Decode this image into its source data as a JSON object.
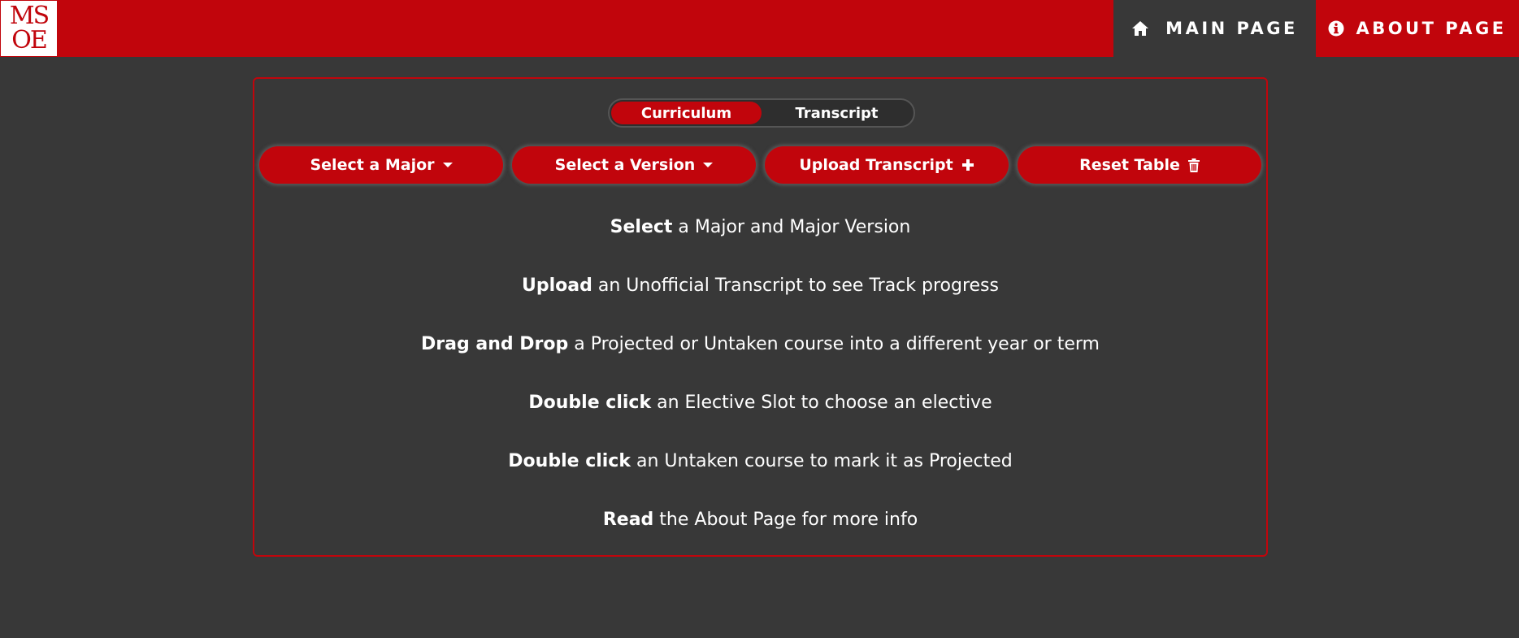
{
  "colors": {
    "brand_red": "#c1050c",
    "background": "#383838",
    "text": "#ffffff"
  },
  "logo": {
    "line1": "MS",
    "line2": "OE"
  },
  "nav": {
    "main_page": {
      "icon": "home-icon",
      "label": "MAIN PAGE"
    },
    "about_page": {
      "icon": "info-circle-icon",
      "label": "ABOUT PAGE"
    }
  },
  "toggle": {
    "options": [
      "Curriculum",
      "Transcript"
    ],
    "active": "Curriculum"
  },
  "buttons": {
    "select_major": {
      "label": "Select a Major",
      "icon": "caret-down-icon"
    },
    "select_version": {
      "label": "Select a Version",
      "icon": "caret-down-icon"
    },
    "upload_transcript": {
      "label": "Upload Transcript",
      "icon": "plus-icon"
    },
    "reset_table": {
      "label": "Reset Table",
      "icon": "trash-icon"
    }
  },
  "instructions": [
    {
      "bold": "Select",
      "text": " a Major and Major Version"
    },
    {
      "bold": "Upload",
      "text": " an Unofficial Transcript to see Track progress"
    },
    {
      "bold": "Drag and Drop",
      "text": " a Projected or Untaken course into a different year or term"
    },
    {
      "bold": "Double click",
      "text": " an Elective Slot to choose an elective"
    },
    {
      "bold": "Double click",
      "text": " an Untaken course to mark it as Projected"
    },
    {
      "bold": "Read",
      "text": " the About Page for more info"
    }
  ]
}
